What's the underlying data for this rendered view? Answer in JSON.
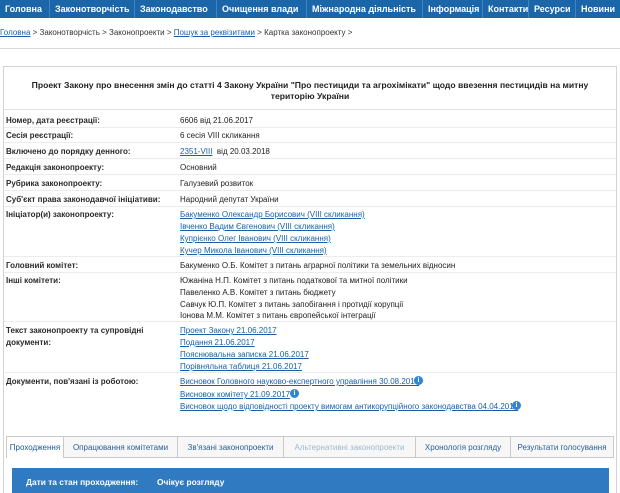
{
  "nav": {
    "items": [
      "Головна",
      "Законотворчість",
      "Законодавство",
      "Очищення влади",
      "Міжнародна діяльність",
      "Інформація",
      "Контакти",
      "Ресурси",
      "Новини"
    ]
  },
  "breadcrumb": {
    "home": "Головна",
    "sep": " > ",
    "lawmaking": "Законотворчість",
    "bills": "Законопроекти",
    "search": "Пошук за реквізитами",
    "card": "Картка законопроекту",
    "trail": " >"
  },
  "bill": {
    "title_line1": "Проект Закону про внесення змін до статті 4 Закону України \"Про пестициди та агрохімікати\" щодо ввезення пестицидів на митну",
    "title_line2": "територію України",
    "fields": {
      "number_label": "Номер, дата реєстрації:",
      "number_value": "6606 від 21.06.2017",
      "session_label": "Сесія реєстрації:",
      "session_value": "6 сесія VIII скликання",
      "agenda_label": "Включено до порядку денного:",
      "agenda_link": "2351-VIII",
      "agenda_date": "від 20.03.2018",
      "committee_edition_label": "Редакція законопроекту:",
      "committee_edition_value": "Основний",
      "rubric_label": "Рубрика законопроекту:",
      "rubric_value": "Галузевий розвиток",
      "subject_label": "Суб'єкт права законодавчої ініціативи:",
      "subject_value": "Народний депутат України",
      "initiators_label": "Ініціатор(и) законопроекту:",
      "initiators": [
        "Бакуменко Олександр Борисович (VIII скликання)",
        "Івченко Вадим Євгенович (VIII скликання)",
        "Купрієнко Олег Іванович (VIII скликання)",
        "Кучер Микола Іванович (VIII скликання)"
      ],
      "main_committee_label": "Головний комітет:",
      "main_committee_value": "Бакуменко О.Б. Комітет з питань аграрної політики та земельних відносин",
      "other_committees_label": "Інші комітети:",
      "other_committees": [
        "Южаніна Н.П. Комітет з питань податкової та митної політики",
        "Павеленко А.В. Комітет з питань бюджету",
        "Савчук Ю.П. Комітет з питань запобігання і протидії корупції",
        "Іонова М.М. Комітет з питань європейської інтеграції"
      ],
      "texts_label_1": "Текст законопроекту та супровідні",
      "texts_label_2": "документи:",
      "texts": [
        "Проект Закону 21.06.2017",
        "Подання 21.06.2017",
        "Пояснювальна записка 21.06.2017",
        "Порівняльна таблиця 21.06.2017"
      ],
      "docs_label": "Документи, пов'язані із роботою:",
      "docs": [
        "Висновок Головного науково-експертного управління 30.08.2017",
        "Висновок комітету 21.09.2017",
        "Висновок щодо відповідності проекту вимогам антикорупційного законодавства 04.04.2018"
      ]
    }
  },
  "tabs": [
    "Проходження",
    "Опрацювання комітетами",
    "Зв'язані законопроекти",
    "Альтернативні законопроекти",
    "Хронологія розгляду",
    "Результати голосування"
  ],
  "stage": {
    "label": "Дати та стан проходження:",
    "value": "Очікує розгляду"
  },
  "colors": {
    "nav": "#1a66a8",
    "link": "#1a5fa8",
    "stage": "#2f7ac0",
    "info_icon": "#2f86cf"
  },
  "icons": {
    "docs_info": "info-icon"
  }
}
